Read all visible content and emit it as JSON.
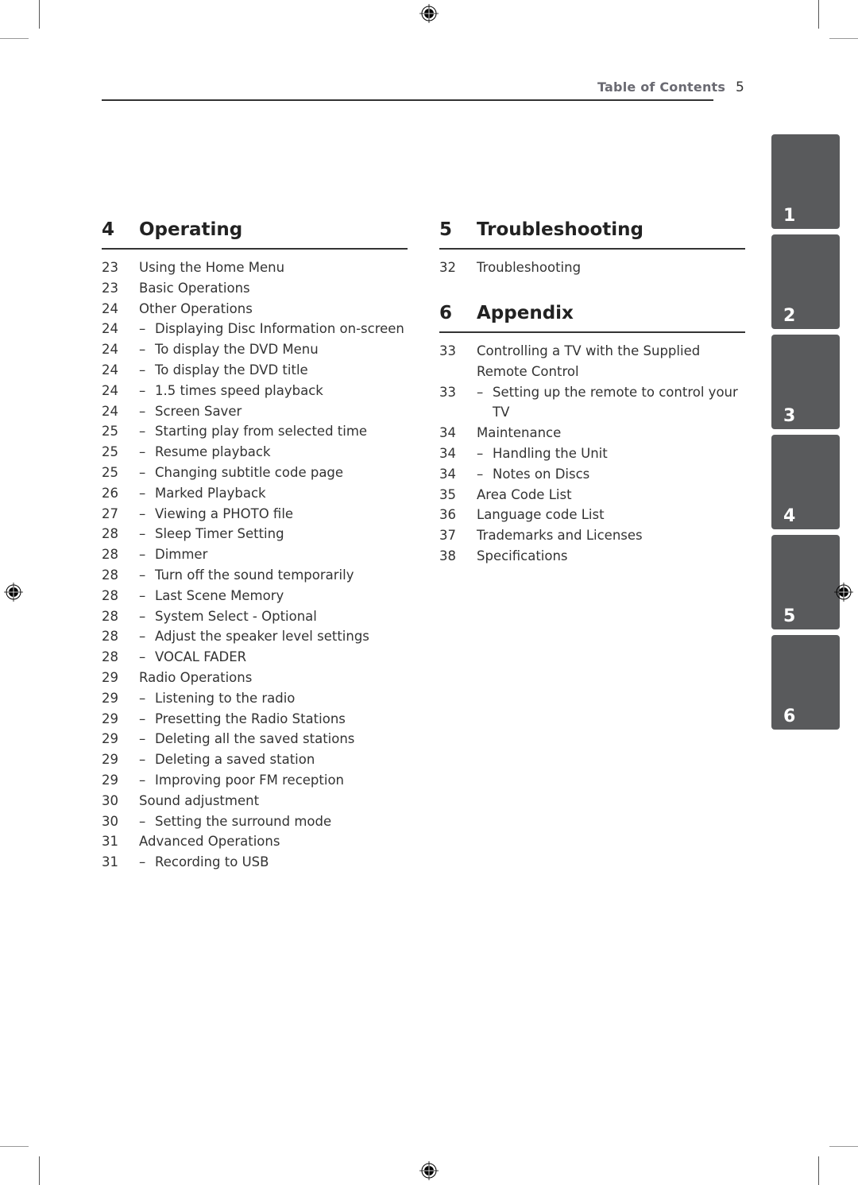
{
  "header": {
    "title": "Table of Contents",
    "page_number": "5"
  },
  "sections": [
    {
      "number": "4",
      "title": "Operating",
      "entries": [
        {
          "page": "23",
          "text": "Using the Home Menu",
          "sub": false
        },
        {
          "page": "23",
          "text": "Basic Operations",
          "sub": false
        },
        {
          "page": "24",
          "text": "Other Operations",
          "sub": false
        },
        {
          "page": "24",
          "text": "Displaying Disc Information on-screen",
          "sub": true
        },
        {
          "page": "24",
          "text": "To display the DVD Menu",
          "sub": true
        },
        {
          "page": "24",
          "text": "To display the DVD title",
          "sub": true
        },
        {
          "page": "24",
          "text": "1.5 times speed playback",
          "sub": true
        },
        {
          "page": "24",
          "text": "Screen Saver",
          "sub": true
        },
        {
          "page": "25",
          "text": "Starting play from selected time",
          "sub": true
        },
        {
          "page": "25",
          "text": "Resume playback",
          "sub": true
        },
        {
          "page": "25",
          "text": "Changing subtitle code page",
          "sub": true
        },
        {
          "page": "26",
          "text": "Marked Playback",
          "sub": true
        },
        {
          "page": "27",
          "text": "Viewing a PHOTO file",
          "sub": true
        },
        {
          "page": "28",
          "text": "Sleep Timer Setting",
          "sub": true
        },
        {
          "page": "28",
          "text": "Dimmer",
          "sub": true
        },
        {
          "page": "28",
          "text": "Turn off the sound temporarily",
          "sub": true
        },
        {
          "page": "28",
          "text": "Last Scene Memory",
          "sub": true
        },
        {
          "page": "28",
          "text": "System Select - Optional",
          "sub": true
        },
        {
          "page": "28",
          "text": "Adjust the speaker level settings",
          "sub": true
        },
        {
          "page": "28",
          "text": "VOCAL FADER",
          "sub": true
        },
        {
          "page": "29",
          "text": "Radio Operations",
          "sub": false
        },
        {
          "page": "29",
          "text": "Listening to the radio",
          "sub": true
        },
        {
          "page": "29",
          "text": "Presetting the Radio Stations",
          "sub": true
        },
        {
          "page": "29",
          "text": "Deleting all the saved stations",
          "sub": true
        },
        {
          "page": "29",
          "text": "Deleting a saved station",
          "sub": true
        },
        {
          "page": "29",
          "text": "Improving poor FM reception",
          "sub": true
        },
        {
          "page": "30",
          "text": "Sound adjustment",
          "sub": false
        },
        {
          "page": "30",
          "text": "Setting the surround mode",
          "sub": true
        },
        {
          "page": "31",
          "text": "Advanced Operations",
          "sub": false
        },
        {
          "page": "31",
          "text": "Recording to USB",
          "sub": true
        }
      ]
    },
    {
      "number": "5",
      "title": "Troubleshooting",
      "entries": [
        {
          "page": "32",
          "text": "Troubleshooting",
          "sub": false
        }
      ]
    },
    {
      "number": "6",
      "title": "Appendix",
      "entries": [
        {
          "page": "33",
          "text": "Controlling a TV with the Supplied",
          "sub": false
        },
        {
          "page": "",
          "text": "Remote Control",
          "sub": false
        },
        {
          "page": "33",
          "text": "Setting up the remote to control your",
          "sub": true
        },
        {
          "page": "",
          "text": "TV",
          "sub": true,
          "cont": true
        },
        {
          "page": "34",
          "text": "Maintenance",
          "sub": false
        },
        {
          "page": "34",
          "text": "Handling the Unit",
          "sub": true
        },
        {
          "page": "34",
          "text": "Notes on Discs",
          "sub": true
        },
        {
          "page": "35",
          "text": "Area Code List",
          "sub": false
        },
        {
          "page": "36",
          "text": "Language code List",
          "sub": false
        },
        {
          "page": "37",
          "text": "Trademarks and Licenses",
          "sub": false
        },
        {
          "page": "38",
          "text": "Specifications",
          "sub": false
        }
      ]
    }
  ],
  "chapter_tabs": [
    "1",
    "2",
    "3",
    "4",
    "5",
    "6"
  ],
  "colors": {
    "tab_background": "#595a5c",
    "header_title": "#6a6a72",
    "text": "#333333"
  }
}
